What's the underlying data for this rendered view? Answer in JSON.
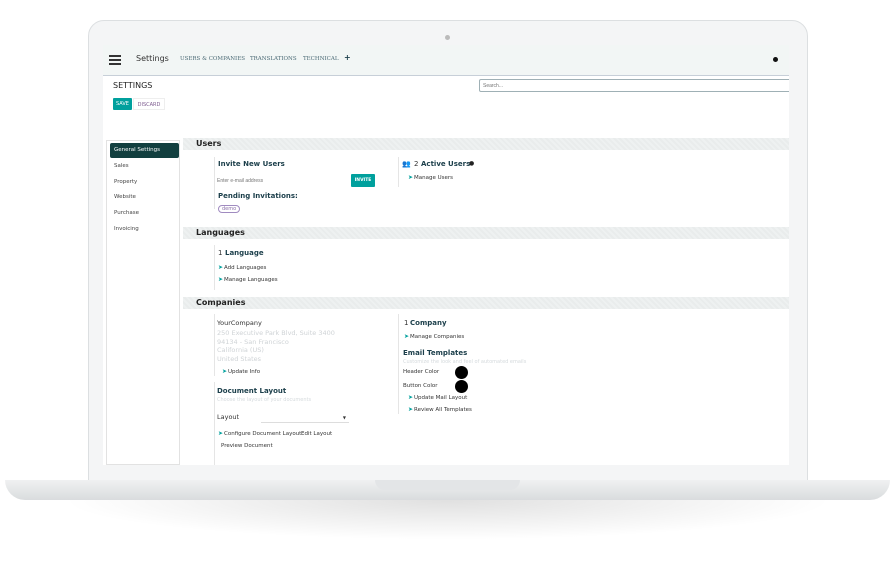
{
  "nav": {
    "app_title": "Settings",
    "menu": [
      "USERS & COMPANIES",
      "TRANSLATIONS",
      "TECHNICAL"
    ],
    "add": "+"
  },
  "control": {
    "title": "SETTINGS",
    "save": "SAVE",
    "discard": "DISCARD",
    "search_placeholder": "Search..."
  },
  "sidebar": {
    "items": [
      "General Settings",
      "Sales",
      "Property",
      "Website",
      "Purchase",
      "Invoicing"
    ]
  },
  "users": {
    "header": "Users",
    "invite_title": "Invite New Users",
    "email_placeholder": "Enter e-mail address",
    "invite": "INVITE",
    "pending": "Pending Invitations:",
    "pending_user": "demo",
    "active_count": "2",
    "active_label": "Active Users",
    "manage": "Manage Users"
  },
  "languages": {
    "header": "Languages",
    "count": "1",
    "label": "Language",
    "add": "Add Languages",
    "manage": "Manage Languages"
  },
  "companies": {
    "header": "Companies",
    "name": "YourCompany",
    "address": [
      "250 Executive Park Blvd, Suite 3400",
      "94134 - San Francisco",
      "California (US)",
      "United States"
    ],
    "update": "Update Info",
    "doc_title": "Document Layout",
    "doc_desc": "Choose the layout of your documents",
    "layout_label": "Layout",
    "configure": "Configure Document Layout",
    "edit": "Edit Layout",
    "preview": "Preview Document",
    "count": "1",
    "count_label": "Company",
    "manage": "Manage Companies",
    "email_title": "Email Templates",
    "email_desc": "Customize the look and feel of automated emails",
    "header_color": "Header Color",
    "button_color": "Button Color",
    "update_mail": "Update Mail Layout",
    "review": "Review All Templates"
  },
  "colors": {
    "accent": "#00a09d",
    "sidebar_active": "#123f3f",
    "swatch": "#000000"
  }
}
